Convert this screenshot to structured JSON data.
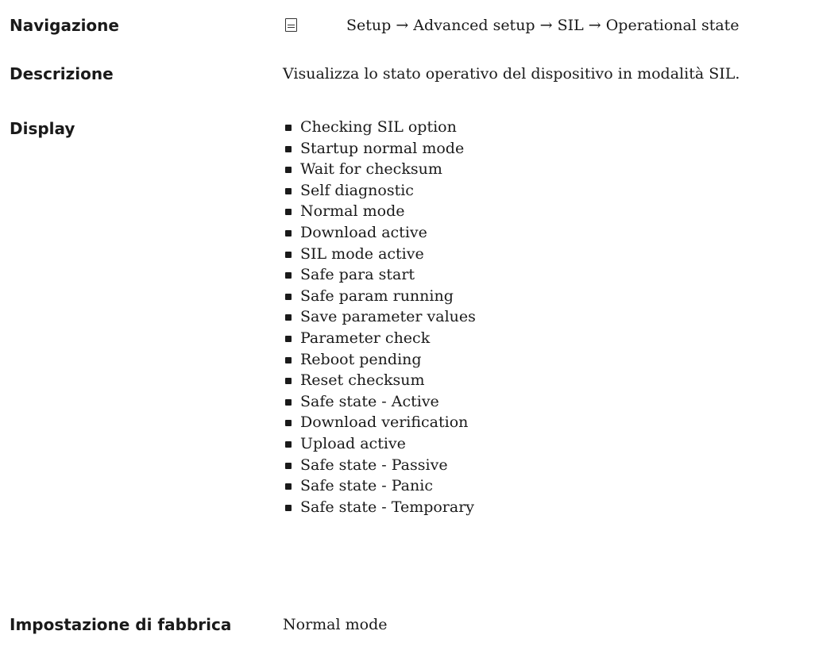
{
  "navigazione": {
    "label": "Navigazione",
    "icon": "menu-list-icon",
    "path": "Setup → Advanced setup → SIL → Operational state"
  },
  "descrizione": {
    "label": "Descrizione",
    "text": "Visualizza lo stato operativo del dispositivo in modalità SIL."
  },
  "display": {
    "label": "Display",
    "items": [
      "Checking SIL option",
      "Startup normal mode",
      "Wait for checksum",
      "Self diagnostic",
      "Normal mode",
      "Download active",
      "SIL mode active",
      "Safe para start",
      "Safe param running",
      "Save parameter values",
      "Parameter check",
      "Reboot pending",
      "Reset checksum",
      "Safe state - Active",
      "Download verification",
      "Upload active",
      "Safe state - Passive",
      "Safe state - Panic",
      "Safe state - Temporary"
    ]
  },
  "impostazione": {
    "label": "Impostazione di fabbrica",
    "value": "Normal mode"
  }
}
